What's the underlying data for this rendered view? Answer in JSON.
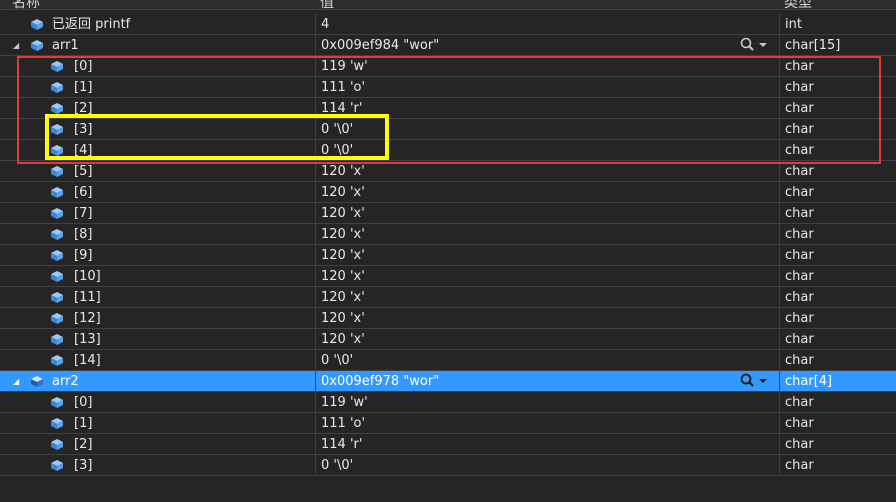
{
  "header": {
    "name": "名称",
    "value": "值",
    "type": "类型"
  },
  "rows": [
    {
      "name": "已返回 printf",
      "value": "4",
      "type": "int"
    },
    {
      "name": "arr1",
      "value": "0x009ef984 \"wor\"",
      "type": "char[15]"
    },
    {
      "name": "[0]",
      "value": "119 'w'",
      "type": "char"
    },
    {
      "name": "[1]",
      "value": "111 'o'",
      "type": "char"
    },
    {
      "name": "[2]",
      "value": "114 'r'",
      "type": "char"
    },
    {
      "name": "[3]",
      "value": "0 '\\0'",
      "type": "char"
    },
    {
      "name": "[4]",
      "value": "0 '\\0'",
      "type": "char"
    },
    {
      "name": "[5]",
      "value": "120 'x'",
      "type": "char"
    },
    {
      "name": "[6]",
      "value": "120 'x'",
      "type": "char"
    },
    {
      "name": "[7]",
      "value": "120 'x'",
      "type": "char"
    },
    {
      "name": "[8]",
      "value": "120 'x'",
      "type": "char"
    },
    {
      "name": "[9]",
      "value": "120 'x'",
      "type": "char"
    },
    {
      "name": "[10]",
      "value": "120 'x'",
      "type": "char"
    },
    {
      "name": "[11]",
      "value": "120 'x'",
      "type": "char"
    },
    {
      "name": "[12]",
      "value": "120 'x'",
      "type": "char"
    },
    {
      "name": "[13]",
      "value": "120 'x'",
      "type": "char"
    },
    {
      "name": "[14]",
      "value": "0 '\\0'",
      "type": "char"
    },
    {
      "name": "arr2",
      "value": "0x009ef978 \"wor\"",
      "type": "char[4]"
    },
    {
      "name": "[0]",
      "value": "119 'w'",
      "type": "char"
    },
    {
      "name": "[1]",
      "value": "111 'o'",
      "type": "char"
    },
    {
      "name": "[2]",
      "value": "114 'r'",
      "type": "char"
    },
    {
      "name": "[3]",
      "value": "0 '\\0'",
      "type": "char"
    }
  ],
  "colors": {
    "icon": "#5aa0e6",
    "selected": "#3399ff",
    "annotation_red": "#e53935",
    "annotation_yellow": "#ffff00"
  },
  "icons": {
    "variable": "cube-icon",
    "expand": "expander-triangle-icon",
    "search": "magnifier-icon",
    "dropdown": "chevron-down-icon"
  }
}
